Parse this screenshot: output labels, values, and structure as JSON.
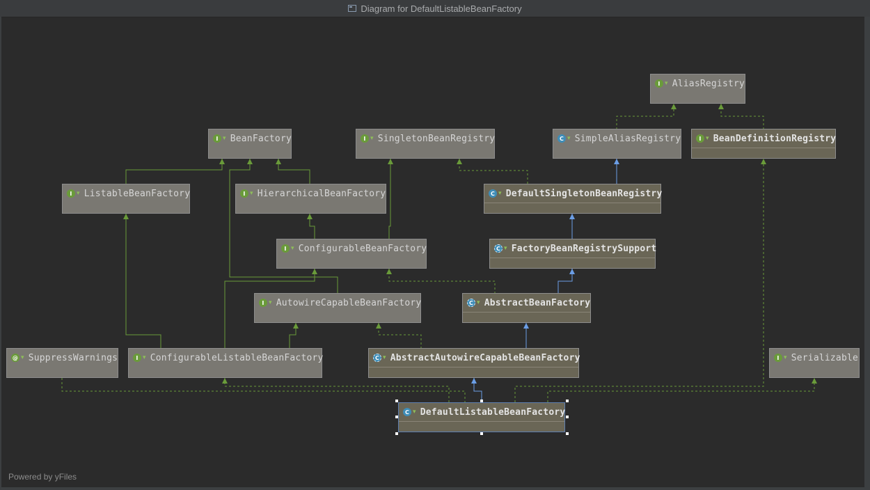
{
  "window": {
    "title": "Diagram for DefaultListableBeanFactory"
  },
  "footer": {
    "powered_by": "Powered by yFiles"
  },
  "nodes": {
    "AliasRegistry": {
      "label": "AliasRegistry",
      "kind": "interface"
    },
    "BeanFactory": {
      "label": "BeanFactory",
      "kind": "interface"
    },
    "SingletonBeanRegistry": {
      "label": "SingletonBeanRegistry",
      "kind": "interface"
    },
    "SimpleAliasRegistry": {
      "label": "SimpleAliasRegistry",
      "kind": "class"
    },
    "BeanDefinitionRegistry": {
      "label": "BeanDefinitionRegistry",
      "kind": "interface"
    },
    "ListableBeanFactory": {
      "label": "ListableBeanFactory",
      "kind": "interface"
    },
    "HierarchicalBeanFactory": {
      "label": "HierarchicalBeanFactory",
      "kind": "interface"
    },
    "DefaultSingletonBeanRegistry": {
      "label": "DefaultSingletonBeanRegistry",
      "kind": "class"
    },
    "ConfigurableBeanFactory": {
      "label": "ConfigurableBeanFactory",
      "kind": "interface"
    },
    "FactoryBeanRegistrySupport": {
      "label": "FactoryBeanRegistrySupport",
      "kind": "abstract-class"
    },
    "AutowireCapableBeanFactory": {
      "label": "AutowireCapableBeanFactory",
      "kind": "interface"
    },
    "AbstractBeanFactory": {
      "label": "AbstractBeanFactory",
      "kind": "abstract-class"
    },
    "SuppressWarnings": {
      "label": "SuppressWarnings",
      "kind": "annotation"
    },
    "ConfigurableListableBeanFactory": {
      "label": "ConfigurableListableBeanFactory",
      "kind": "interface"
    },
    "AbstractAutowireCapableBeanFactory": {
      "label": "AbstractAutowireCapableBeanFactory",
      "kind": "abstract-class"
    },
    "Serializable": {
      "label": "Serializable",
      "kind": "interface"
    },
    "DefaultListableBeanFactory": {
      "label": "DefaultListableBeanFactory",
      "kind": "class"
    }
  },
  "colors": {
    "extends_interface": "#6a9b3a",
    "extends_class": "#6b9ee6",
    "implements": "#6a9b3a"
  }
}
